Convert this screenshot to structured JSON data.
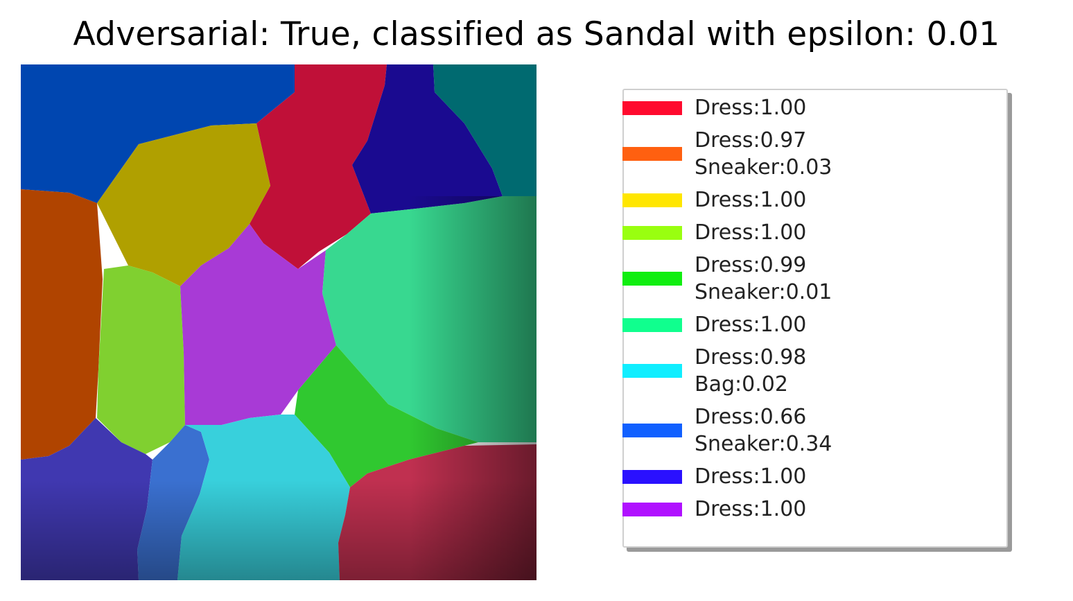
{
  "title": "Adversarial: True, classified as Sandal with epsilon: 0.01",
  "legend": [
    {
      "color": "#ff0a2e",
      "lines": [
        "Dress:1.00"
      ]
    },
    {
      "color": "#ff6010",
      "lines": [
        "Dress:0.97",
        "Sneaker:0.03"
      ]
    },
    {
      "color": "#ffe600",
      "lines": [
        "Dress:1.00"
      ]
    },
    {
      "color": "#99ff10",
      "lines": [
        "Dress:1.00"
      ]
    },
    {
      "color": "#10ee10",
      "lines": [
        "Dress:0.99",
        "Sneaker:0.01"
      ]
    },
    {
      "color": "#10ff8e",
      "lines": [
        "Dress:1.00"
      ]
    },
    {
      "color": "#10eeff",
      "lines": [
        "Dress:0.98",
        "Bag:0.02"
      ]
    },
    {
      "color": "#1060ff",
      "lines": [
        "Dress:0.66",
        "Sneaker:0.34"
      ]
    },
    {
      "color": "#2a10ff",
      "lines": [
        "Dress:1.00"
      ]
    },
    {
      "color": "#b010ff",
      "lines": [
        "Dress:1.00"
      ]
    }
  ],
  "segments": [
    {
      "name": "segment-top-left-blue",
      "color": "#0046b0"
    },
    {
      "name": "segment-top-red",
      "color": "#c01038"
    },
    {
      "name": "segment-top-navy",
      "color": "#1a0a90"
    },
    {
      "name": "segment-top-right-teal",
      "color": "#006a70"
    },
    {
      "name": "segment-olive",
      "color": "#b0a000"
    },
    {
      "name": "segment-left-orange",
      "color": "#b04400"
    },
    {
      "name": "segment-left-green",
      "color": "#80d030"
    },
    {
      "name": "segment-center-purple",
      "color": "#a83ad6"
    },
    {
      "name": "segment-right-mint",
      "color": "#38d890"
    },
    {
      "name": "segment-bright-green",
      "color": "#30c830"
    },
    {
      "name": "segment-bottom-left-indigo",
      "color": "#4038b0"
    },
    {
      "name": "segment-bottom-blue",
      "color": "#3a70d0"
    },
    {
      "name": "segment-bottom-cyan",
      "color": "#38d0dc"
    },
    {
      "name": "segment-bottom-right-crimson",
      "color": "#c03050"
    }
  ]
}
